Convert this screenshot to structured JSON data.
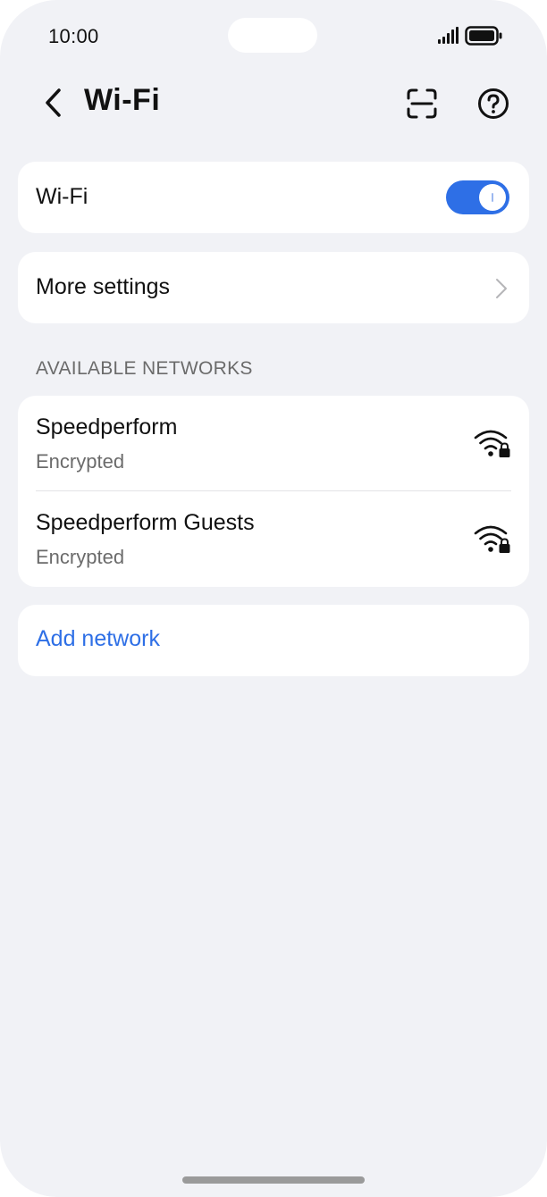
{
  "status_bar": {
    "time": "10:00",
    "signal_icon": "cellular-signal-icon",
    "battery_icon": "battery-full-icon"
  },
  "header": {
    "title": "Wi-Fi",
    "back_icon": "chevron-left-icon",
    "scan_icon": "scan-qr-icon",
    "help_icon": "help-circle-icon"
  },
  "wifi_toggle": {
    "label": "Wi-Fi",
    "state": "on",
    "accent_color": "#2e6fe6"
  },
  "more_settings": {
    "label": "More settings"
  },
  "available_networks": {
    "header": "AVAILABLE NETWORKS",
    "items": [
      {
        "name": "Speedperform",
        "status": "Encrypted",
        "icon": "wifi-locked-icon"
      },
      {
        "name": "Speedperform Guests",
        "status": "Encrypted",
        "icon": "wifi-locked-icon"
      }
    ]
  },
  "add_network": {
    "label": "Add network"
  }
}
